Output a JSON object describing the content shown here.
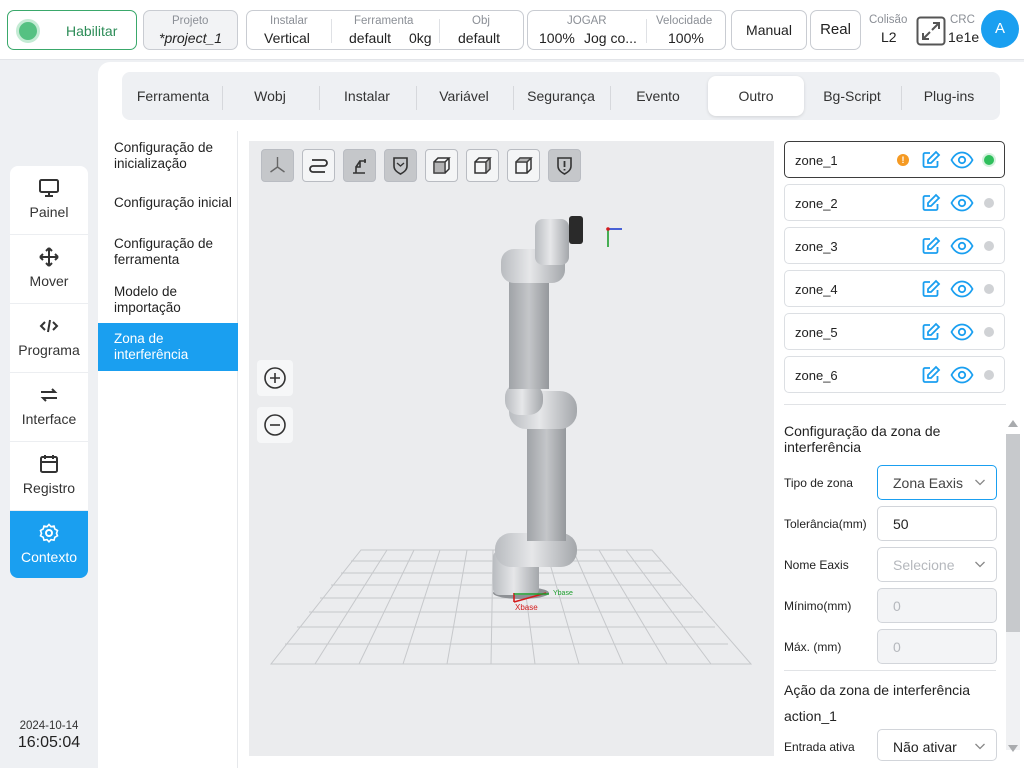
{
  "header": {
    "enable_label": "Habilitar",
    "project": {
      "caption": "Projeto",
      "value": "*project_1"
    },
    "install": {
      "caption": "Instalar",
      "value": "Vertical"
    },
    "tool": {
      "caption": "Ferramenta",
      "value": "default",
      "weight": "0kg"
    },
    "obj": {
      "caption": "Obj",
      "value": "default"
    },
    "jog": {
      "caption": "JOGAR",
      "value_pct": "100%",
      "value_mode": "Jog co..."
    },
    "speed": {
      "caption": "Velocidade",
      "value": "100%"
    },
    "manual_label": "Manual",
    "real_label": "Real",
    "collision": {
      "caption": "Colisão",
      "value": "L2"
    },
    "crc": {
      "caption": "CRC",
      "value": "1e1e"
    },
    "avatar_letter": "A"
  },
  "left_nav": {
    "items": [
      {
        "label": "Painel",
        "icon": "monitor-icon"
      },
      {
        "label": "Mover",
        "icon": "move-icon"
      },
      {
        "label": "Programa",
        "icon": "code-icon"
      },
      {
        "label": "Interface",
        "icon": "swap-icon"
      },
      {
        "label": "Registro",
        "icon": "calendar-icon"
      },
      {
        "label": "Contexto",
        "icon": "gear-icon",
        "active": true
      }
    ]
  },
  "datetime": {
    "date": "2024-10-14",
    "time": "16:05:04"
  },
  "tabs": [
    "Ferramenta",
    "Wobj",
    "Instalar",
    "Variável",
    "Segurança",
    "Evento",
    "Outro",
    "Bg-Script",
    "Plug-ins"
  ],
  "active_tab": "Outro",
  "submenu": [
    {
      "label": "Configuração de inicialização"
    },
    {
      "label": "Configuração inicial"
    },
    {
      "label": "Configuração de ferramenta"
    },
    {
      "label": "Modelo de importação"
    },
    {
      "label": "Zona de interferência",
      "active": true
    }
  ],
  "viewport": {
    "axis_labels": {
      "x_base": "Xbase",
      "y_base": "Ybase"
    },
    "view_tools": [
      "axes-view-icon",
      "path-view-icon",
      "robot-view-icon",
      "shield-view-icon",
      "cube-front-icon",
      "cube-side-icon",
      "cube-top-icon",
      "shield-alert-icon"
    ]
  },
  "zones": [
    {
      "name": "zone_1",
      "warning": true,
      "active": true
    },
    {
      "name": "zone_2",
      "warning": false,
      "active": false
    },
    {
      "name": "zone_3",
      "warning": false,
      "active": false
    },
    {
      "name": "zone_4",
      "warning": false,
      "active": false
    },
    {
      "name": "zone_5",
      "warning": false,
      "active": false
    },
    {
      "name": "zone_6",
      "warning": false,
      "active": false
    }
  ],
  "zone_config": {
    "title": "Configuração da zona de interferência",
    "zone_type": {
      "label": "Tipo de zona",
      "value": "Zona Eaxis"
    },
    "tolerance": {
      "label": "Tolerância(mm)",
      "value": "50"
    },
    "eaxis_name": {
      "label": "Nome Eaxis",
      "placeholder": "Selecione"
    },
    "minimum": {
      "label": "Mínimo(mm)",
      "value": "0"
    },
    "maximum": {
      "label": "Máx. (mm)",
      "value": "0"
    },
    "action_title": "Ação da zona de interferência",
    "action_name": "action_1",
    "active_input": {
      "label": "Entrada ativa",
      "value": "Não ativar"
    }
  },
  "colors": {
    "accent": "#1a9ff0",
    "enable_green": "#55c182",
    "warning": "#f59a23",
    "active_status": "#2fbf5c"
  }
}
